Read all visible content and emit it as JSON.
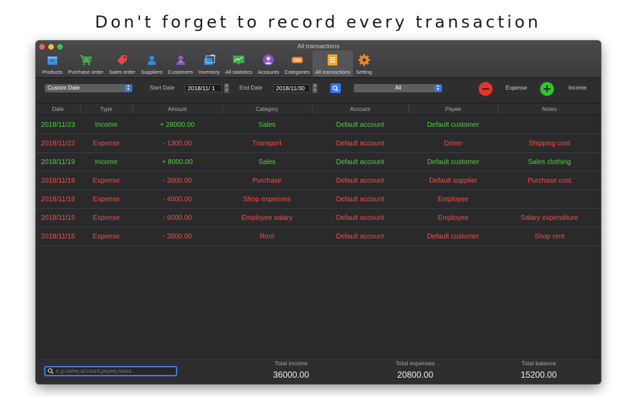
{
  "headline": "Don't forget to record every transaction",
  "window": {
    "title": "All transactions"
  },
  "toolbar": [
    {
      "label": "Products",
      "icon": "products-icon",
      "color": "#3a8fdc"
    },
    {
      "label": "Purchase order",
      "icon": "shopping-cart-icon",
      "color": "#4caf50"
    },
    {
      "label": "Sales order",
      "icon": "price-tag-icon",
      "color": "#e84545"
    },
    {
      "label": "Suppliers",
      "icon": "supplier-person-icon",
      "color": "#2f8ae0"
    },
    {
      "label": "Customers",
      "icon": "customers-icon",
      "color": "#8e5bd0"
    },
    {
      "label": "Inventory",
      "icon": "inventory-box-icon",
      "color": "#3b8edb"
    },
    {
      "label": "All statistics",
      "icon": "statistics-chart-icon",
      "color": "#3ea84a"
    },
    {
      "label": "Accounts",
      "icon": "accounts-icon",
      "color": "#8c4fc9"
    },
    {
      "label": "Categories",
      "icon": "categories-icon",
      "color": "#f07f26"
    },
    {
      "label": "All transactions",
      "icon": "transactions-list-icon",
      "color": "#f3a531"
    },
    {
      "label": "Setting",
      "icon": "gear-icon",
      "color": "#f08a22"
    }
  ],
  "filters": {
    "date_range": "Custom Date",
    "start_label": "Start Date",
    "start_value": "2018/11/ 1",
    "end_label": "End Date",
    "end_value": "2018/11/30",
    "type_filter": "All",
    "expense_label": "Expense",
    "income_label": "Income"
  },
  "columns": [
    "Date",
    "Type",
    "Amount",
    "Category",
    "Account",
    "Payee",
    "Notes"
  ],
  "rows": [
    {
      "date": "2018/11/23",
      "type": "Income",
      "amount": "+ 28000.00",
      "category": "Sales",
      "account": "Default account",
      "payee": "Default customer",
      "notes": "",
      "kind": "income"
    },
    {
      "date": "2018/11/22",
      "type": "Expense",
      "amount": "- 1300.00",
      "category": "Transport",
      "account": "Default account",
      "payee": "Driver",
      "notes": "Shipping cost",
      "kind": "expense"
    },
    {
      "date": "2018/11/19",
      "type": "Income",
      "amount": "+ 8000.00",
      "category": "Sales",
      "account": "Default account",
      "payee": "Default customer",
      "notes": "Sales clothing",
      "kind": "income"
    },
    {
      "date": "2018/11/19",
      "type": "Expense",
      "amount": "- 3000.00",
      "category": "Purchase",
      "account": "Default account",
      "payee": "Default supplier",
      "notes": "Purchase cost",
      "kind": "expense"
    },
    {
      "date": "2018/11/19",
      "type": "Expense",
      "amount": "- 4000.00",
      "category": "Shop expenses",
      "account": "Default account",
      "payee": "Employee",
      "notes": "",
      "kind": "expense"
    },
    {
      "date": "2018/11/15",
      "type": "Expense",
      "amount": "- 9000.00",
      "category": "Employee salary",
      "account": "Default account",
      "payee": "Employee",
      "notes": "Salary expenditure",
      "kind": "expense"
    },
    {
      "date": "2018/11/15",
      "type": "Expense",
      "amount": "- 3500.00",
      "category": "Rent",
      "account": "Default account",
      "payee": "Default customer",
      "notes": "Shop rent",
      "kind": "expense"
    }
  ],
  "footer": {
    "search_placeholder": "e.g.name,account,payee,notes..",
    "total_income_label": "Total income",
    "total_income": "36000.00",
    "total_expenses_label": "Total expenses",
    "total_expenses": "20800.00",
    "total_balance_label": "Total balance",
    "total_balance": "15200.00"
  },
  "colors": {
    "income": "#4fd23c",
    "expense": "#ff4a40",
    "accent": "#3578f6"
  }
}
